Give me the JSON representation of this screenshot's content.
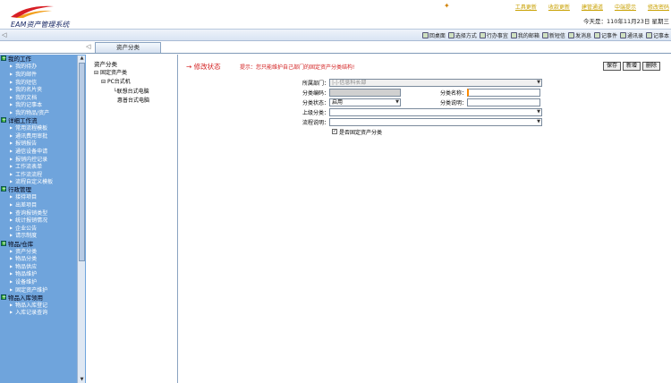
{
  "app": {
    "title": "EAM资产管理系统"
  },
  "header": {
    "links": [
      "工具更新",
      "收款更新",
      "建管通道",
      "中端提示",
      "修改密码"
    ],
    "today": "今天是：110年11月23日  星期三"
  },
  "toolbar": {
    "left_glyph": "◁",
    "items": [
      {
        "label": "回桌面",
        "icon": "home-icon"
      },
      {
        "label": "选择方式",
        "icon": "settings-icon"
      },
      {
        "label": "行办事宜",
        "icon": "tasks-icon"
      },
      {
        "label": "我的邮箱",
        "icon": "mail-icon"
      },
      {
        "label": "新短信",
        "icon": "sms-icon"
      },
      {
        "label": "发消息",
        "icon": "message-icon"
      },
      {
        "label": "记事件",
        "icon": "note-icon"
      },
      {
        "label": "通讯录",
        "icon": "contacts-icon"
      },
      {
        "label": "记事本",
        "icon": "notebook-icon"
      }
    ]
  },
  "tabs": {
    "active": "资产分类",
    "left_glyph": "◁"
  },
  "sidebar": {
    "groups": [
      {
        "label": "我的工作",
        "items": [
          "我的待办",
          "我的邮件",
          "我的短信",
          "我的名片夹",
          "我的文档",
          "我的记事本",
          "我的物品/资产"
        ]
      },
      {
        "label": "详细工作流",
        "items": [
          "常用流程模板",
          "通讯费用审批",
          "报销报告",
          "通信设备申请",
          "报销内控记录",
          "工作流表单",
          "工作流流程",
          "流程自定义模板"
        ]
      },
      {
        "label": "行政管理",
        "items": [
          "接待项目",
          "出差项目",
          "查询报销类型",
          "统计报销情况",
          "企业公告",
          "请示制度"
        ]
      },
      {
        "label": "物品/仓库",
        "items": [
          "资产分类",
          "物品分类",
          "物品供应",
          "物品维护",
          "设备维护",
          "固定资产维护"
        ]
      },
      {
        "label": "物品入库领用",
        "items": [
          "物品入库登记",
          "入库记录查询"
        ]
      }
    ]
  },
  "tree": {
    "title": "资产分类",
    "nodes": [
      "固定资产类",
      "PC台式机",
      "联想台式电脑",
      "惠普台式电脑"
    ]
  },
  "main": {
    "heading": "→ 修改状态",
    "hint": "提示：您只能维护自己部门的固定资产分类结构!",
    "buttons": [
      "保存",
      "新增",
      "删除"
    ],
    "form": {
      "dept_label": "所属部门：",
      "dept_value": "|-|-信息科长部",
      "code_label": "分类编码：",
      "code_value": "",
      "name_label": "分类名称：",
      "name_value": "",
      "status_label": "分类状态：",
      "status_value": "启用",
      "desc_label": "分类说明：",
      "desc_value": "",
      "parent_label": "上级分类：",
      "parent_value": "",
      "flow_label": "流程说明：",
      "flow_value": "",
      "checkbox_label": "是否固定资产分类",
      "checkbox_checked": true
    }
  },
  "colors": {
    "sidebar": "#6fa4dc",
    "accent_red": "#d32020",
    "link_gold": "#c8a000"
  }
}
